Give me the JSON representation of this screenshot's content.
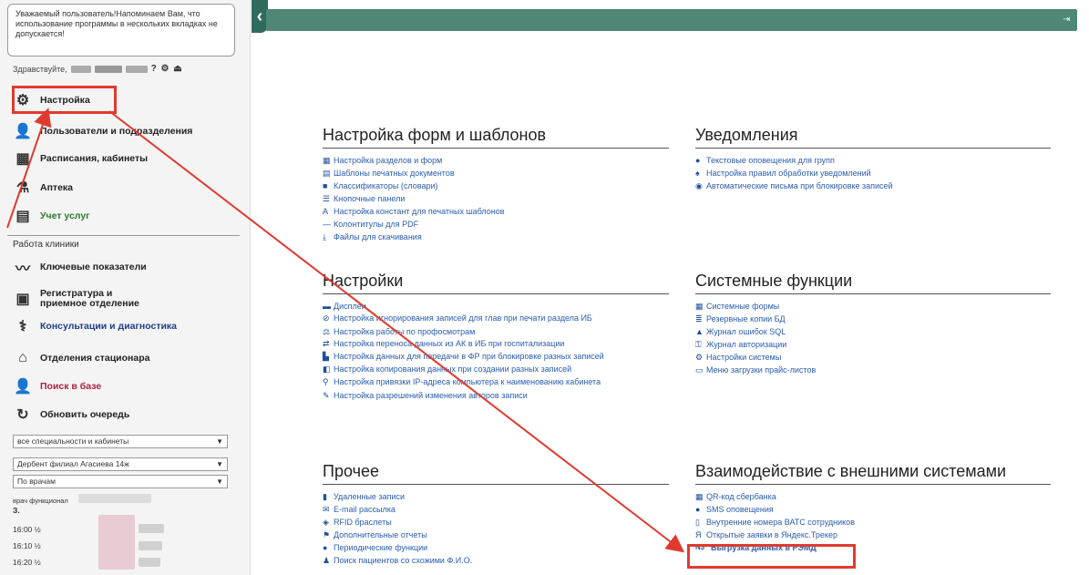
{
  "sidebar": {
    "notice": "Уважаемый пользователь!Напоминаем Вам, что использование программы в нескольких вкладках не допускается!",
    "greeting": "Здравствуйте,",
    "greeting_icons": "? ⚙ ⏏",
    "menu_top": [
      {
        "label": "Настройка",
        "icon": "gear-icon"
      },
      {
        "label": "Пользователи и подразделения",
        "icon": "users-icon"
      },
      {
        "label": "Расписания, кабинеты",
        "icon": "schedule-icon"
      },
      {
        "label": "Аптека",
        "icon": "pharmacy-icon"
      },
      {
        "label": "Учет услуг",
        "icon": "services-icon"
      }
    ],
    "clinic_label": "Работа клиники",
    "menu_clinic": [
      {
        "label": "Ключевые показатели",
        "icon": "chart-icon"
      },
      {
        "label": "Регистратура и приемное отделение",
        "icon": "registry-icon"
      },
      {
        "label": "Консультации и диагностика",
        "icon": "consult-icon"
      },
      {
        "label": "Отделения стационара",
        "icon": "hospital-icon"
      },
      {
        "label": "Поиск в базе",
        "icon": "search-user-icon"
      },
      {
        "label": "Обновить очередь",
        "icon": "refresh-icon"
      }
    ],
    "selects": [
      "все специальности и кабинеты",
      "Дербент филиал Агасиева 14ж",
      "По врачам"
    ],
    "doctor_label": "врач функционал",
    "doctor_sub": "З.",
    "times": [
      "16:00 ½",
      "16:10 ½",
      "16:20 ½"
    ]
  },
  "sections": {
    "forms": {
      "title": "Настройка форм и шаблонов",
      "items": [
        {
          "label": "Настройка разделов и форм",
          "icon": "table-icon"
        },
        {
          "label": "Шаблоны печатных документов",
          "icon": "document-icon"
        },
        {
          "label": "Классификаторы (словари)",
          "icon": "book-icon"
        },
        {
          "label": "Кнопочные панели",
          "icon": "list-icon"
        },
        {
          "label": "Настройка констант для печатных шаблонов",
          "icon": "font-icon"
        },
        {
          "label": "Колонтитулы для PDF",
          "icon": "minus-icon"
        },
        {
          "label": "Файлы для скачивания",
          "icon": "download-icon"
        }
      ]
    },
    "notifications": {
      "title": "Уведомления",
      "items": [
        {
          "label": "Текстовые оповещения для групп",
          "icon": "comment-icon"
        },
        {
          "label": "Настройка правил обработки уведомлений",
          "icon": "bell-icon"
        },
        {
          "label": "Автоматические письма при блокировке записей",
          "icon": "at-icon"
        }
      ]
    },
    "settings": {
      "title": "Настройки",
      "items": [
        {
          "label": "Дисплеи",
          "icon": "display-icon"
        },
        {
          "label": "Настройка игнорирования записей для глав при печати раздела ИБ",
          "icon": "ban-icon"
        },
        {
          "label": "Настройка работы по профосмотрам",
          "icon": "scale-icon"
        },
        {
          "label": "Настройка переноса данных из АК в ИБ при госпитализации",
          "icon": "exchange-icon"
        },
        {
          "label": "Настройка данных для передачи в ФР при блокировке разных записей",
          "icon": "building-icon"
        },
        {
          "label": "Настройка копирования данных при создании разных записей",
          "icon": "copy-icon"
        },
        {
          "label": "Настройка привязки IP-адреса компьютера к наименованию кабинета",
          "icon": "sitemap-icon"
        },
        {
          "label": "Настройка разрешений изменения авторов записи",
          "icon": "pen-icon"
        }
      ]
    },
    "system": {
      "title": "Системные функции",
      "items": [
        {
          "label": "Системные формы",
          "icon": "grid-icon"
        },
        {
          "label": "Резервные копии БД",
          "icon": "database-icon"
        },
        {
          "label": "Журнал ошибок SQL",
          "icon": "warning-icon"
        },
        {
          "label": "Журнал авторизации",
          "icon": "key-icon"
        },
        {
          "label": "Настройки системы",
          "icon": "cogs-icon"
        },
        {
          "label": "Меню загрузки прайс-листов",
          "icon": "upload-icon"
        }
      ]
    },
    "other": {
      "title": "Прочее",
      "items": [
        {
          "label": "Удаленные записи",
          "icon": "trash-icon"
        },
        {
          "label": "E-mail рассылка",
          "icon": "envelope-icon"
        },
        {
          "label": "RFID браслеты",
          "icon": "rfid-icon"
        },
        {
          "label": "Дополнительные отчеты",
          "icon": "flag-icon"
        },
        {
          "label": "Периодические функции",
          "icon": "clock-icon"
        },
        {
          "label": "Поиск пациентов со схожими Ф.И.О.",
          "icon": "people-icon"
        }
      ]
    },
    "external": {
      "title": "Взаимодействие с внешними системами",
      "items": [
        {
          "label": "QR-код сбербанка",
          "icon": "qr-icon"
        },
        {
          "label": "SMS оповещения",
          "icon": "sms-icon"
        },
        {
          "label": "Внутренние номера ВАТС сотрудников",
          "icon": "phone-icon"
        },
        {
          "label": "Открытые заявки в Яндекс.Трекер",
          "icon": "tracker-icon"
        },
        {
          "label": "Выгрузка данных в РЭМД",
          "icon": "n3-icon",
          "badge": "N3"
        }
      ]
    }
  },
  "colors": {
    "topbar": "#4e8677",
    "link": "#2a5db0",
    "annotation": "#e03a2f"
  }
}
